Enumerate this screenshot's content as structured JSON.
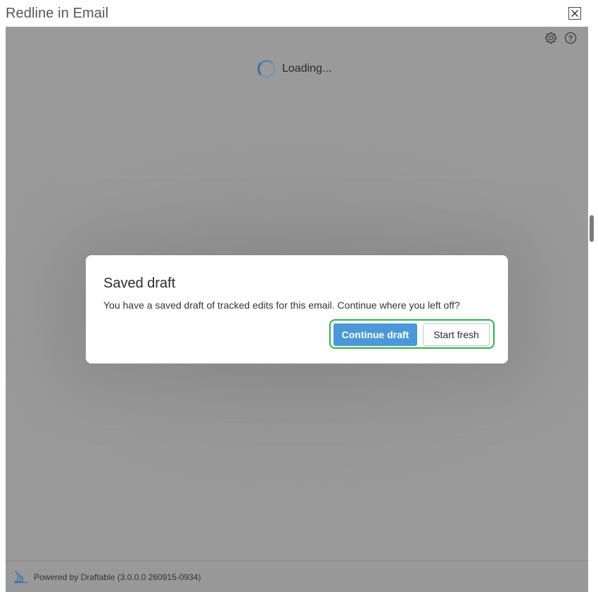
{
  "window": {
    "title": "Redline in Email",
    "close_icon": "close-icon"
  },
  "toolbar": {
    "settings_icon": "gear-icon",
    "help_icon": "help-icon"
  },
  "loading": {
    "text": "Loading..."
  },
  "dialog": {
    "title": "Saved draft",
    "message": "You have a saved draft of tracked edits for this email. Continue where you left off?",
    "primary_label": "Continue draft",
    "secondary_label": "Start fresh",
    "highlight_color": "#2db24a",
    "primary_color": "#4a98d8"
  },
  "footer": {
    "logo_icon": "draftable-logo-icon",
    "text": "Powered by Draftable (3.0.0.0 260915-0934)"
  }
}
